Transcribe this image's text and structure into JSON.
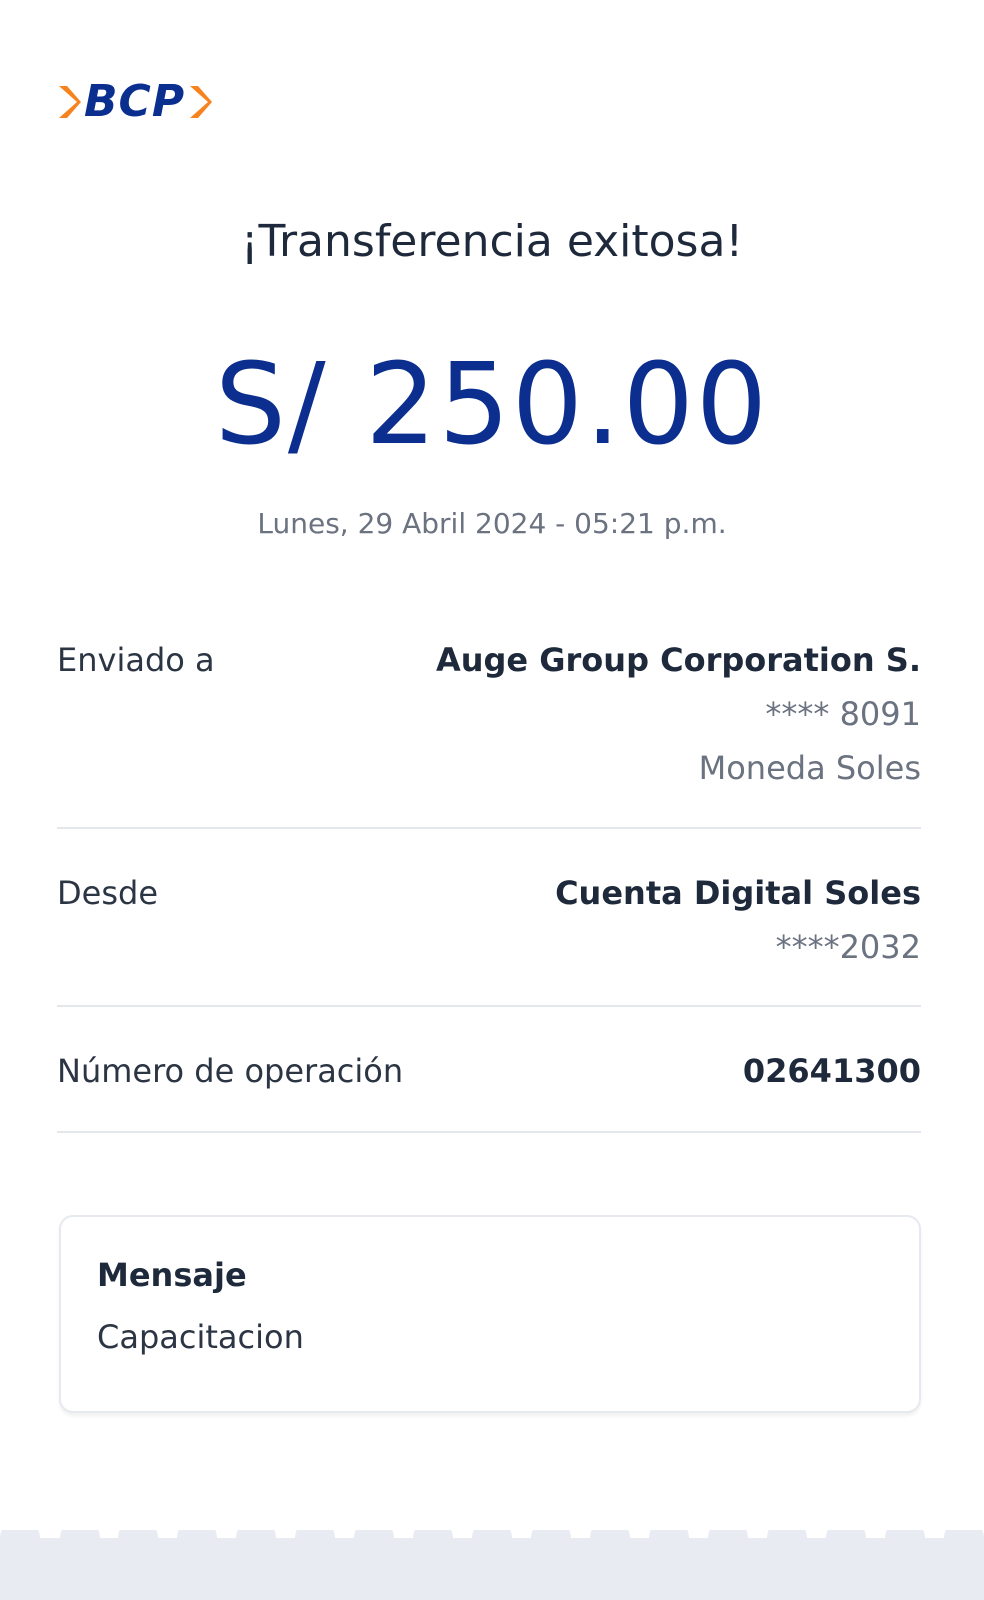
{
  "brand": {
    "logo_text": "BCP",
    "primary_color": "#0b2e8f",
    "accent_color": "#f7831e"
  },
  "receipt": {
    "title": "¡Transferencia exitosa!",
    "amount": "S/ 250.00",
    "datetime": "Lunes, 29 Abril 2024 - 05:21 p.m."
  },
  "details": {
    "sent_to": {
      "label": "Enviado a",
      "name": "Auge Group Corporation S.",
      "account": "**** 8091",
      "currency": "Moneda Soles"
    },
    "from": {
      "label": "Desde",
      "account_name": "Cuenta Digital Soles",
      "account": "****2032"
    },
    "operation": {
      "label": "Número de operación",
      "number": "02641300"
    }
  },
  "message": {
    "title": "Mensaje",
    "text": "Capacitacion"
  },
  "icons": {
    "logo_left": "chevron-right-icon",
    "logo_right": "chevron-right-icon"
  }
}
